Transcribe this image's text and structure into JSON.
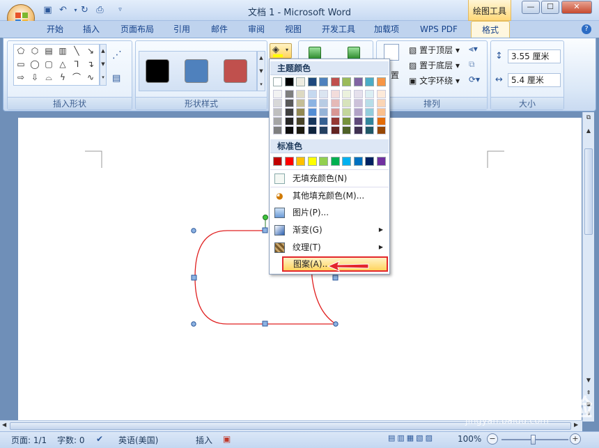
{
  "window": {
    "title": "文档 1 - Microsoft Word",
    "context_tools": "绘图工具",
    "min": "—",
    "max": "☐",
    "close": "✕"
  },
  "qat": [
    "save-icon",
    "undo-icon",
    "redo-icon",
    "print-preview-icon",
    "customize-icon"
  ],
  "tabs": [
    "开始",
    "插入",
    "页面布局",
    "引用",
    "邮件",
    "审阅",
    "视图",
    "开发工具",
    "加载项",
    "WPS PDF"
  ],
  "active_tab": "格式",
  "groups": {
    "insert_shapes": "插入形状",
    "shape_styles": "形状样式",
    "arrange": "排列",
    "size": "大小"
  },
  "style_swatches": [
    "#000000",
    "#4f81bd",
    "#c0504d"
  ],
  "arrange": {
    "bring_front": "置于顶层",
    "send_back": "置于底层",
    "wrap": "文字环绕",
    "position_partial": "置"
  },
  "size": {
    "height": "3.55 厘米",
    "width": "5.4 厘米"
  },
  "menu": {
    "theme_colors": "主题颜色",
    "standard_colors": "标准色",
    "no_fill": "无填充颜色(N)",
    "more_colors": "其他填充颜色(M)...",
    "picture": "图片(P)...",
    "gradient": "渐变(G)",
    "texture": "纹理(T)",
    "pattern": "图案(A)..."
  },
  "theme_colors": {
    "top": [
      "#ffffff",
      "#000000",
      "#eeece1",
      "#1f497d",
      "#4f81bd",
      "#c0504d",
      "#9bbb59",
      "#8064a2",
      "#4bacc6",
      "#f79646"
    ],
    "columns": [
      [
        "#f2f2f2",
        "#d8d8d8",
        "#bfbfbf",
        "#a5a5a5",
        "#7f7f7f"
      ],
      [
        "#7f7f7f",
        "#595959",
        "#3f3f3f",
        "#262626",
        "#0c0c0c"
      ],
      [
        "#ddd9c3",
        "#c4bd97",
        "#938953",
        "#494429",
        "#1d1b10"
      ],
      [
        "#c6d9f0",
        "#8db3e2",
        "#548dd4",
        "#17365d",
        "#0f243e"
      ],
      [
        "#dbe5f1",
        "#b8cce4",
        "#95b3d7",
        "#366092",
        "#244061"
      ],
      [
        "#f2dcdb",
        "#e5b9b7",
        "#d99694",
        "#953734",
        "#632423"
      ],
      [
        "#ebf1dd",
        "#d7e3bc",
        "#c3d69b",
        "#76923c",
        "#4f6128"
      ],
      [
        "#e5e0ec",
        "#ccc1d9",
        "#b2a2c7",
        "#5f497a",
        "#3f3151"
      ],
      [
        "#dbeef3",
        "#b7dde8",
        "#92cddc",
        "#31859b",
        "#205867"
      ],
      [
        "#fdeada",
        "#fbd5b5",
        "#fac08f",
        "#e36c09",
        "#974806"
      ]
    ]
  },
  "standard_colors": [
    "#c00000",
    "#ff0000",
    "#ffc000",
    "#ffff00",
    "#92d050",
    "#00b050",
    "#00b0f0",
    "#0070c0",
    "#002060",
    "#7030a0"
  ],
  "status": {
    "page": "页面: 1/1",
    "words": "字数: 0",
    "lang": "英语(美国)",
    "mode": "插入",
    "zoom": "100%"
  },
  "watermark": {
    "main": "Bai du 经验",
    "sub": "jingyan.baidu.com"
  }
}
